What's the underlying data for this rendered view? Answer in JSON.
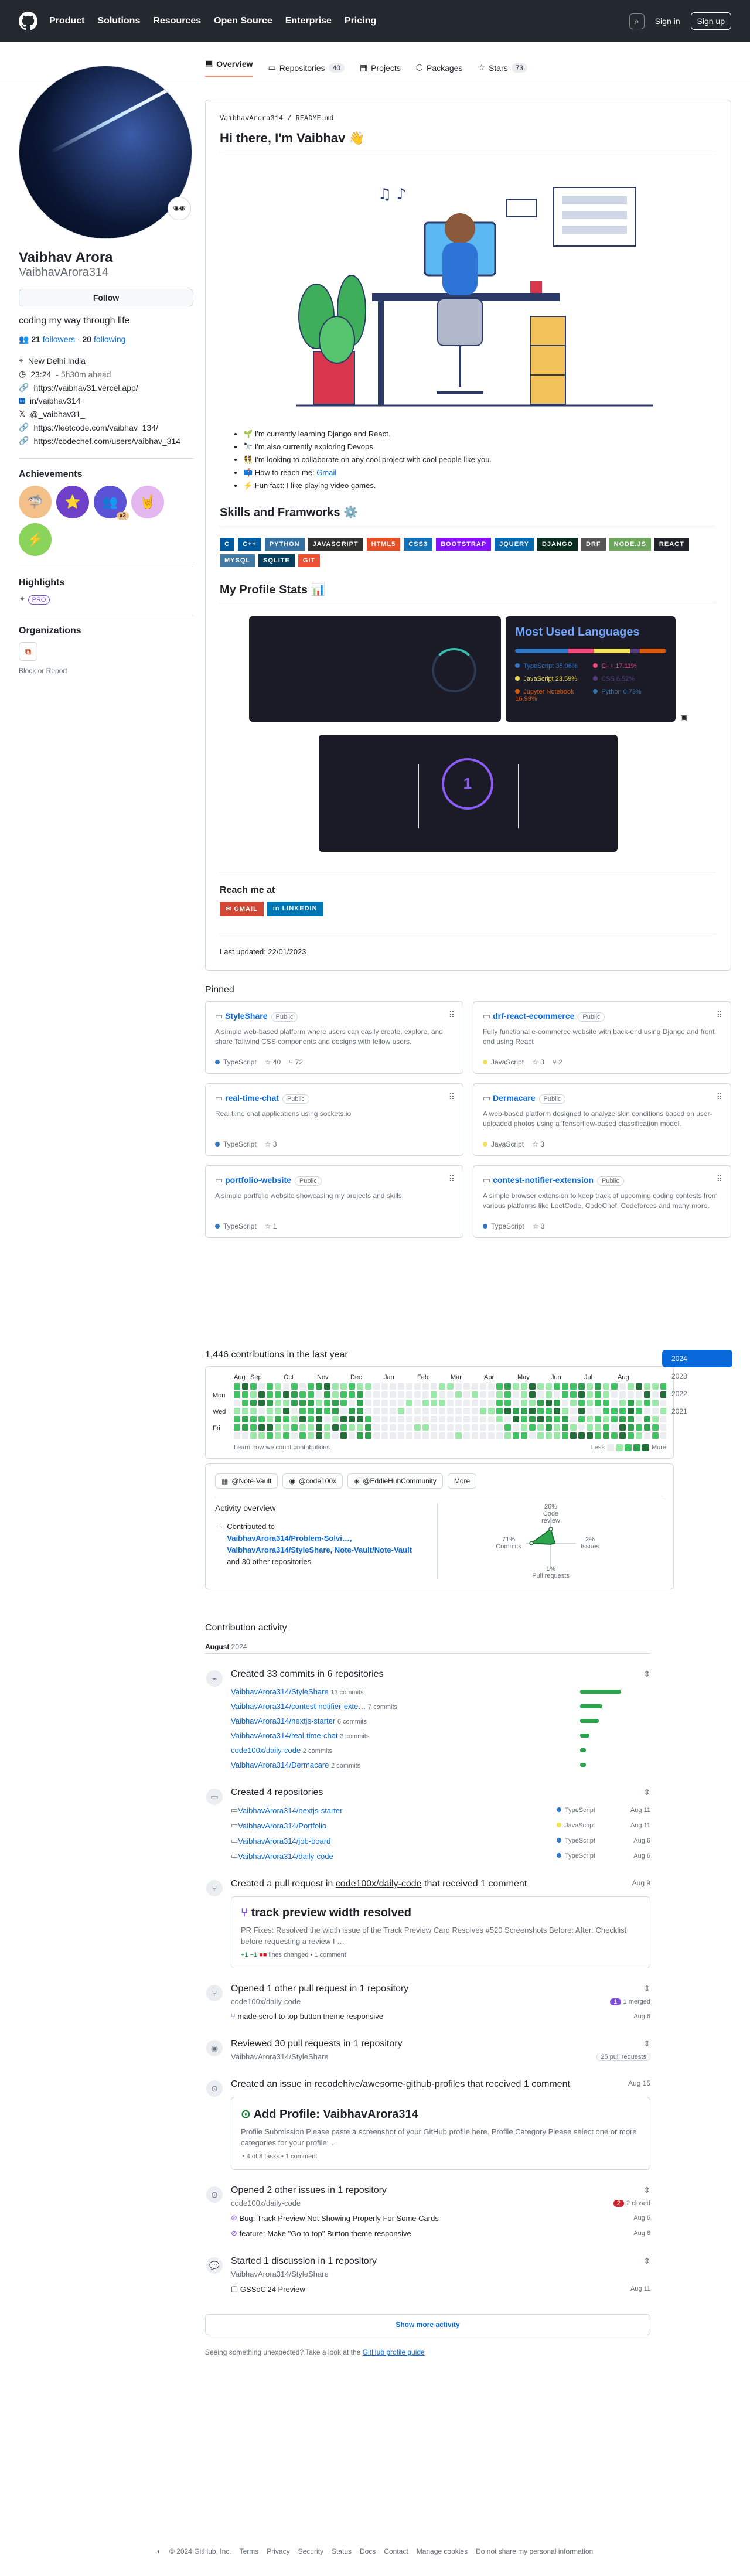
{
  "nav": {
    "product": "Product",
    "solutions": "Solutions",
    "resources": "Resources",
    "open_source": "Open Source",
    "enterprise": "Enterprise",
    "pricing": "Pricing",
    "sign_in": "Sign in",
    "sign_up": "Sign up"
  },
  "tabs": {
    "overview": "Overview",
    "repositories": "Repositories",
    "repo_count": "40",
    "projects": "Projects",
    "packages": "Packages",
    "stars": "Stars",
    "star_count": "73"
  },
  "profile": {
    "name": "Vaibhav Arora",
    "login": "VaibhavArora314",
    "follow": "Follow",
    "bio": "coding my way through life",
    "followers_count": "21",
    "followers_label": "followers",
    "following_count": "20",
    "following_label": "following",
    "location": "New Delhi India",
    "time": "23:24",
    "time_note": "- 5h30m ahead",
    "website": "https://vaibhav31.vercel.app/",
    "linkedin": "in/vaibhav314",
    "twitter": "@_vaibhav31_",
    "leetcode": "https://leetcode.com/vaibhav_134/",
    "codechef": "https://codechef.com/users/vaibhav_314",
    "achievements": "Achievements",
    "achievement_count": "x2",
    "highlights": "Highlights",
    "pro": "PRO",
    "organizations": "Organizations",
    "block": "Block or Report"
  },
  "readme": {
    "path": "VaibhavArora314 / README.md",
    "heading": "Hi there, I'm Vaibhav 👋",
    "points": [
      "🌱 I'm currently learning Django and React.",
      "🔭 I'm also currently exploring Devops.",
      "👯 I'm looking to collaborate on any cool project with cool people like you.",
      "📫 How to reach me: ",
      "⚡ Fun fact: I like playing video games."
    ],
    "gmail": "Gmail",
    "skills_heading": "Skills and Framworks ⚙️",
    "skills": [
      {
        "t": "C",
        "c": "#00599c"
      },
      {
        "t": "C++",
        "c": "#00599c"
      },
      {
        "t": "PYTHON",
        "c": "#3670a0"
      },
      {
        "t": "JAVASCRIPT",
        "c": "#323330"
      },
      {
        "t": "HTML5",
        "c": "#e34f26"
      },
      {
        "t": "CSS3",
        "c": "#1572b6"
      },
      {
        "t": "BOOTSTRAP",
        "c": "#8511fa"
      },
      {
        "t": "JQUERY",
        "c": "#0769ad"
      },
      {
        "t": "DJANGO",
        "c": "#092e20"
      },
      {
        "t": "DRF",
        "c": "#555555"
      },
      {
        "t": "NODE.JS",
        "c": "#6da55f"
      },
      {
        "t": "REACT",
        "c": "#20232a"
      },
      {
        "t": "MYSQL",
        "c": "#4479a1"
      },
      {
        "t": "SQLITE",
        "c": "#07405e"
      },
      {
        "t": "GIT",
        "c": "#f05033"
      }
    ],
    "stats_heading": "My Profile Stats 📊",
    "lang_title": "Most Used Languages",
    "langs": [
      {
        "n": "TypeScript",
        "p": "35.06%",
        "c": "#3178c6"
      },
      {
        "n": "C++",
        "p": "17.11%",
        "c": "#f34b7d"
      },
      {
        "n": "JavaScript",
        "p": "23.59%",
        "c": "#f1e05a"
      },
      {
        "n": "CSS",
        "p": "6.52%",
        "c": "#563d7c"
      },
      {
        "n": "Jupyter Notebook",
        "p": "16.99%",
        "c": "#da5b0b"
      },
      {
        "n": "Python",
        "p": "0.73%",
        "c": "#3572a5"
      }
    ],
    "streak": "1",
    "reach_heading": "Reach me at",
    "gmail_btn": "GMAIL",
    "linkedin_btn": "LINKEDIN",
    "updated": "Last updated: 22/01/2023"
  },
  "pinned": {
    "title": "Pinned",
    "public": "Public",
    "repos": [
      {
        "name": "StyleShare",
        "desc": "A simple web-based platform where users can easily create, explore, and share Tailwind CSS components and designs with fellow users.",
        "lang": "TypeScript",
        "lc": "#3178c6",
        "stars": "40",
        "forks": "72"
      },
      {
        "name": "drf-react-ecommerce",
        "desc": "Fully functional e-commerce website with back-end using Django and front end using React",
        "lang": "JavaScript",
        "lc": "#f1e05a",
        "stars": "3",
        "forks": "2"
      },
      {
        "name": "real-time-chat",
        "desc": "Real time chat applications using sockets.io",
        "lang": "TypeScript",
        "lc": "#3178c6",
        "stars": "3",
        "forks": ""
      },
      {
        "name": "Dermacare",
        "desc": "A web-based platform designed to analyze skin conditions based on user-uploaded photos using a Tensorflow-based classification model.",
        "lang": "JavaScript",
        "lc": "#f1e05a",
        "stars": "3",
        "forks": ""
      },
      {
        "name": "portfolio-website",
        "desc": "A simple portfolio website showcasing my projects and skills.",
        "lang": "TypeScript",
        "lc": "#3178c6",
        "stars": "1",
        "forks": ""
      },
      {
        "name": "contest-notifier-extension",
        "desc": "A simple browser extension to keep track of upcoming coding contests from various platforms like LeetCode, CodeChef, Codeforces and many more.",
        "lang": "TypeScript",
        "lc": "#3178c6",
        "stars": "3",
        "forks": ""
      }
    ]
  },
  "contrib": {
    "title": "1,446 contributions in the last year",
    "months": [
      "Aug",
      "Sep",
      "Oct",
      "Nov",
      "Dec",
      "Jan",
      "Feb",
      "Mar",
      "Apr",
      "May",
      "Jun",
      "Jul",
      "Aug"
    ],
    "days": [
      "Mon",
      "Wed",
      "Fri"
    ],
    "learn": "Learn how we count contributions",
    "less": "Less",
    "more": "More",
    "years": [
      "2024",
      "2023",
      "2022",
      "2021"
    ],
    "orgs": [
      "@Note-Vault",
      "@code100x",
      "@EddieHubCommunity"
    ],
    "more_btn": "More",
    "overview": "Activity overview",
    "contributed": "Contributed to",
    "contrib_repos": "VaibhavArora314/Problem-Solvi…, VaibhavArora314/StyleShare, Note-Vault/Note-Vault",
    "others": "and 30 other repositories",
    "code_review": "Code review",
    "cr_pct": "26%",
    "commits": "Commits",
    "cm_pct": "71%",
    "issues": "Issues",
    "is_pct": "2%",
    "prs": "Pull requests",
    "pr_pct": "1%"
  },
  "activity": {
    "title": "Contribution activity",
    "month": "August",
    "year": "2024",
    "commits_title": "Created 33 commits in 6 repositories",
    "commit_repos": [
      {
        "r": "VaibhavArora314/StyleShare",
        "n": "13 commits",
        "w": "70"
      },
      {
        "r": "VaibhavArora314/contest-notifier-exte…",
        "n": "7 commits",
        "w": "38"
      },
      {
        "r": "VaibhavArora314/nextjs-starter",
        "n": "6 commits",
        "w": "32"
      },
      {
        "r": "VaibhavArora314/real-time-chat",
        "n": "3 commits",
        "w": "16"
      },
      {
        "r": "code100x/daily-code",
        "n": "2 commits",
        "w": "10"
      },
      {
        "r": "VaibhavArora314/Dermacare",
        "n": "2 commits",
        "w": "10"
      }
    ],
    "repos_title": "Created 4 repositories",
    "new_repos": [
      {
        "r": "VaibhavArora314/nextjs-starter",
        "l": "TypeScript",
        "c": "#3178c6",
        "d": "Aug 11"
      },
      {
        "r": "VaibhavArora314/Portfolio",
        "l": "JavaScript",
        "c": "#f1e05a",
        "d": "Aug 11"
      },
      {
        "r": "VaibhavArora314/job-board",
        "l": "TypeScript",
        "c": "#3178c6",
        "d": "Aug 6"
      },
      {
        "r": "VaibhavArora314/daily-code",
        "l": "TypeScript",
        "c": "#3178c6",
        "d": "Aug 6"
      }
    ],
    "pr_title_pre": "Created a pull request in",
    "pr_repo": "code100x/daily-code",
    "pr_title_post": "that received 1 comment",
    "pr_date": "Aug 9",
    "pr_name": "track preview width resolved",
    "pr_body": "PR Fixes: Resolved the width issue of the Track Preview Card Resolves #520 Screenshots Before: After: Checklist before requesting a review I …",
    "pr_changes": "+1 −1",
    "pr_lines": "lines changed",
    "pr_comment": "• 1 comment",
    "opened_pr_title": "Opened 1 other pull request in 1 repository",
    "opened_pr_repo": "code100x/daily-code",
    "merged": "1 merged",
    "opened_pr": "made scroll to top button theme responsive",
    "opened_pr_date": "Aug 6",
    "reviewed_title": "Reviewed 30 pull requests in 1 repository",
    "reviewed_repo": "VaibhavArora314/StyleShare",
    "reviewed_count": "25 pull requests",
    "issue_title_pre": "Created an issue in",
    "issue_repo": "recodehive/awesome-github-profiles",
    "issue_title_post": "that received 1 comment",
    "issue_date": "Aug 15",
    "issue_name": "Add Profile: VaibhavArora314",
    "issue_body": "Profile Submission Please paste a screenshot of your GitHub profile here. Profile Category Please select one or more categories for your profile: …",
    "issue_tasks": "4 of 8 tasks",
    "issue_comment": "• 1 comment",
    "opened_issues_title": "Opened 2 other issues in 1 repository",
    "opened_issues_repo": "code100x/daily-code",
    "closed": "2 closed",
    "issue1": "Bug: Track Preview Not Showing Properly For Some Cards",
    "issue1_date": "Aug 6",
    "issue2": "feature: Make \"Go to top\" Button theme responsive",
    "issue2_date": "Aug 6",
    "discussion_title": "Started 1 discussion in 1 repository",
    "discussion_repo": "VaibhavArora314/StyleShare",
    "discussion": "GSSoC'24 Preview",
    "discussion_date": "Aug 11",
    "show_more": "Show more activity",
    "unexpected": "Seeing something unexpected? Take a look at the",
    "guide": "GitHub profile guide"
  },
  "footer": {
    "copy": "© 2024 GitHub, Inc.",
    "links": [
      "Terms",
      "Privacy",
      "Security",
      "Status",
      "Docs",
      "Contact",
      "Manage cookies",
      "Do not share my personal information"
    ]
  }
}
